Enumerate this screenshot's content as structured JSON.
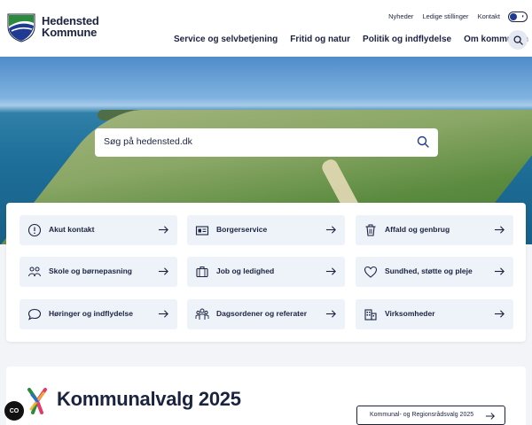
{
  "brand": {
    "line1": "Hedensted",
    "line2": "Kommune"
  },
  "top_links": [
    "Nyheder",
    "Ledige stillinger",
    "Kontakt"
  ],
  "main_nav": [
    "Service og selvbetjening",
    "Fritid og natur",
    "Politik og indflydelse",
    "Om kommunen"
  ],
  "search": {
    "placeholder": "Søg på hedensted.dk"
  },
  "quick_links": [
    {
      "label": "Akut kontakt",
      "icon": "alert-circle-icon"
    },
    {
      "label": "Borgerservice",
      "icon": "id-card-icon"
    },
    {
      "label": "Affald og genbrug",
      "icon": "trash-icon"
    },
    {
      "label": "Skole og børnepasning",
      "icon": "children-icon"
    },
    {
      "label": "Job og ledighed",
      "icon": "briefcase-icon"
    },
    {
      "label": "Sundhed, støtte og pleje",
      "icon": "heart-icon"
    },
    {
      "label": "Høringer og indflydelse",
      "icon": "speech-bubble-icon"
    },
    {
      "label": "Dagsordener og referater",
      "icon": "people-icon"
    },
    {
      "label": "Virksomheder",
      "icon": "building-icon"
    }
  ],
  "election": {
    "title": "Kommunalvalg 2025",
    "button_label": "Kommunal- og Regionsrådsvalg 2025"
  },
  "cookie": {
    "label": "CO"
  },
  "colors": {
    "navy": "#1b2340",
    "tile_bg": "#eef3f9",
    "logo_green": "#2c8a3e",
    "logo_blue": "#1f3a93"
  }
}
